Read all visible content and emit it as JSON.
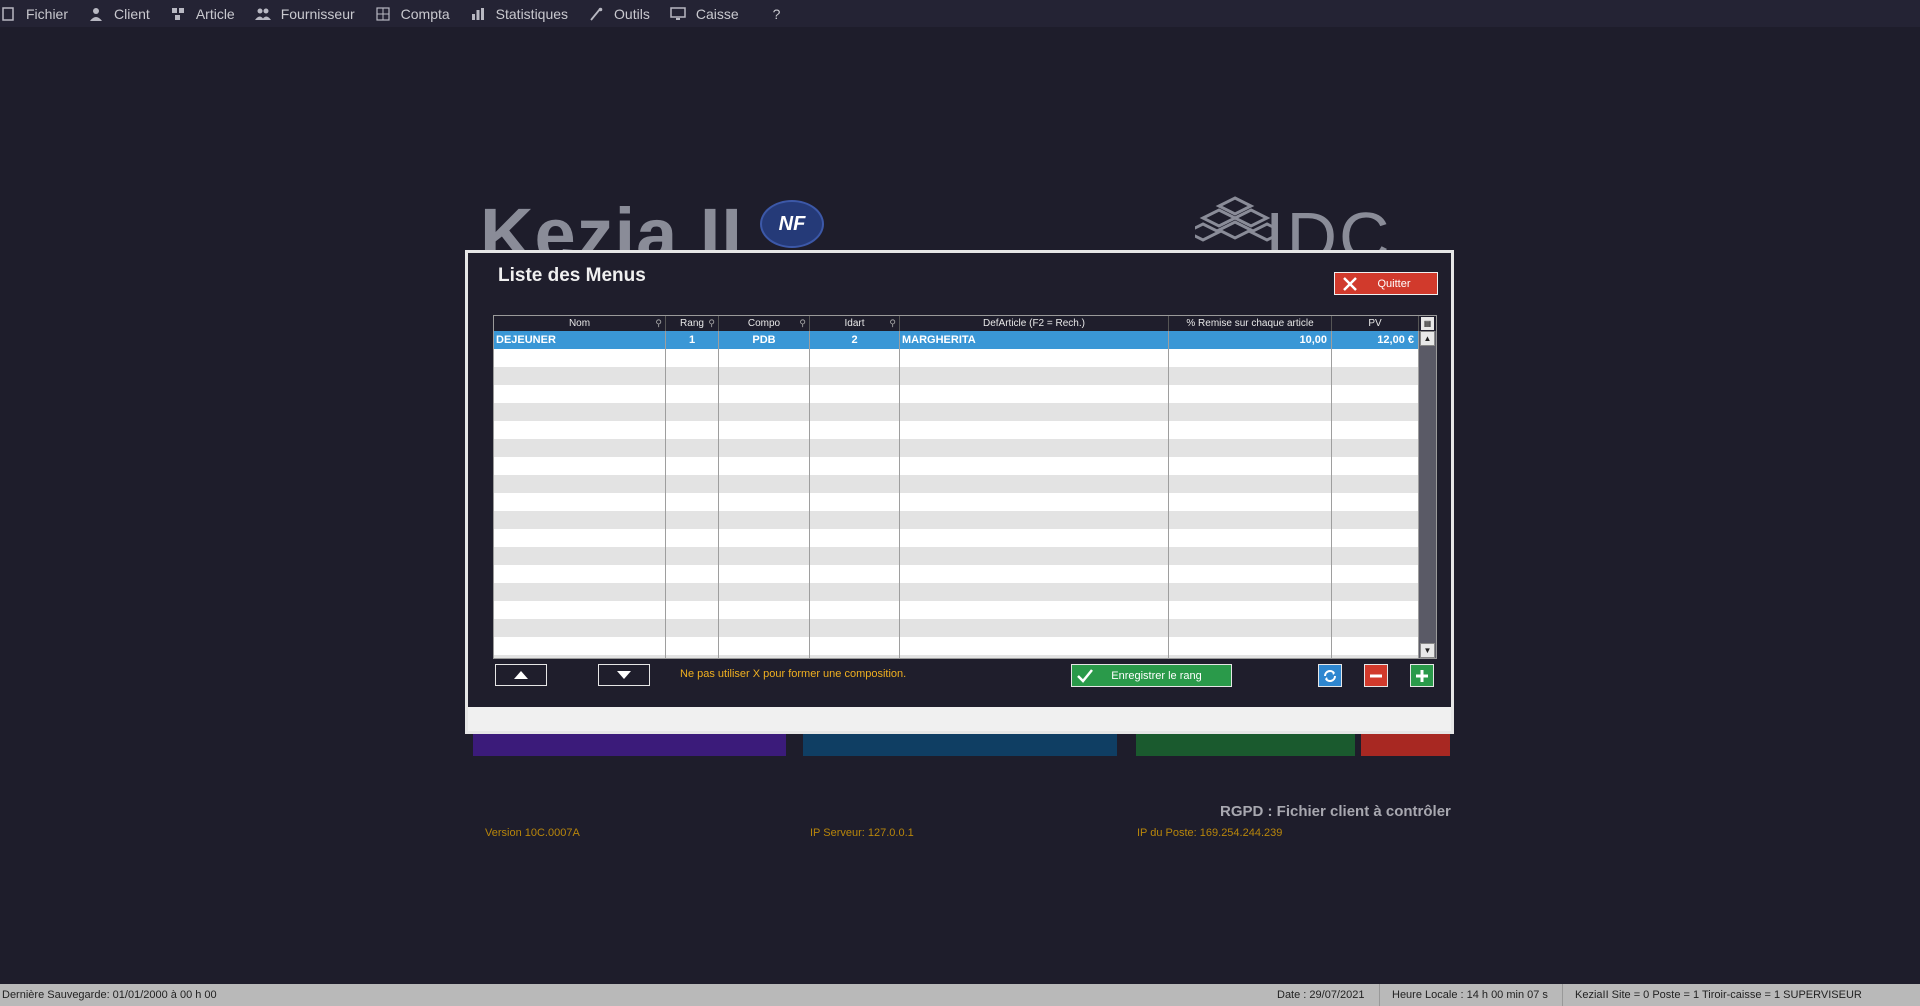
{
  "menubar": {
    "items": [
      {
        "label": "Fichier",
        "icon": "file-icon"
      },
      {
        "label": "Client",
        "icon": "person-icon"
      },
      {
        "label": "Article",
        "icon": "tag-icon"
      },
      {
        "label": "Fournisseur",
        "icon": "people-icon"
      },
      {
        "label": "Compta",
        "icon": "calculator-icon"
      },
      {
        "label": "Statistiques",
        "icon": "bar-chart-icon"
      },
      {
        "label": "Outils",
        "icon": "wrench-icon"
      },
      {
        "label": "Caisse",
        "icon": "monitor-icon"
      },
      {
        "label": "?",
        "icon": ""
      }
    ]
  },
  "splash": {
    "brand": "Kezia II",
    "nf_badge": "NF",
    "partner": "IDC",
    "rgpd": "RGPD : Fichier client à contrôler",
    "version": "Version 10C.0007A",
    "ip_server": "IP Serveur: 127.0.0.1",
    "ip_poste": "IP du Poste: 169.254.244.239",
    "tile_colors": [
      "#3b1b7a",
      "#0f3e63",
      "#1a5a2e",
      "#a82822"
    ]
  },
  "dialog": {
    "title": "Liste des Menus",
    "quit_label": "Quitter",
    "columns": [
      "Nom",
      "Rang",
      "Compo",
      "Idart",
      "DefArticle (F2 = Rech.)",
      "% Remise sur chaque article",
      "PV"
    ],
    "rows": [
      [
        "DEJEUNER",
        "1",
        "PDB",
        "2",
        "MARGHERITA",
        "10,00",
        "12,00 €"
      ]
    ],
    "hint": "Ne pas utiliser X pour former une composition.",
    "save_rank_label": "Enregistrer le rang"
  },
  "statusbar": {
    "last_backup": "Dernière Sauvegarde: 01/01/2000 à 00 h 00",
    "date": "Date : 29/07/2021",
    "local_time": "Heure Locale : 14 h 00 min 07 s",
    "session": "KeziaII  Site = 0  Poste = 1  Tiroir-caisse = 1 SUPERVISEUR"
  },
  "colors": {
    "background": "#1e1d2b",
    "selection": "#3a97d6",
    "quit": "#d13a2c",
    "save": "#2a9a4a",
    "hint": "#f0b020"
  }
}
